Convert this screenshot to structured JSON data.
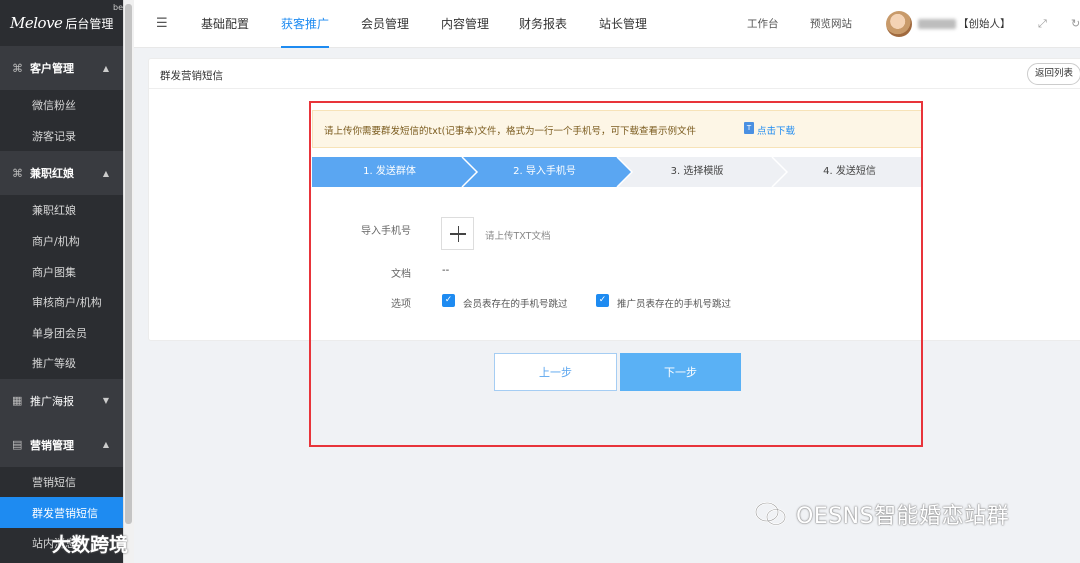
{
  "sidebar": {
    "logo_script": "Melove",
    "logo_admin": "后台管理",
    "logo_badge": "be",
    "groups": [
      {
        "label": "客户管理",
        "icon": "user-group-icon",
        "items": [
          "微信粉丝",
          "游客记录"
        ]
      },
      {
        "label": "兼职红娘",
        "icon": "user-group-icon",
        "items": [
          "兼职红娘",
          "商户/机构",
          "商户图集",
          "审核商户/机构",
          "单身团会员",
          "推广等级"
        ]
      },
      {
        "label": "推广海报",
        "icon": "calendar-icon",
        "items": []
      },
      {
        "label": "营销管理",
        "icon": "message-icon",
        "items": [
          "营销短信",
          "群发营销短信",
          "站内消息"
        ]
      }
    ],
    "active_item": "群发营销短信"
  },
  "topbar": {
    "menu_icon": "menu-toggle-icon",
    "tabs": [
      "基础配置",
      "获客推广",
      "会员管理",
      "内容管理",
      "财务报表",
      "站长管理"
    ],
    "active_tab": "获客推广",
    "workbench": "工作台",
    "preview": "预览网站",
    "user_role": "【创始人】",
    "icons": [
      "fullscreen-icon",
      "refresh-icon"
    ]
  },
  "page": {
    "title": "群发营销短信",
    "back_button": "返回列表",
    "notice_text": "请上传你需要群发短信的txt(记事本)文件，格式为一行一个手机号，可下载查看示例文件",
    "notice_link": "点击下载",
    "steps": [
      {
        "label": "1. 发送群体",
        "state": "done"
      },
      {
        "label": "2. 导入手机号",
        "state": "active"
      },
      {
        "label": "3. 选择模版",
        "state": "todo"
      },
      {
        "label": "4. 发送短信",
        "state": "todo"
      }
    ],
    "form": {
      "import_label": "导入手机号",
      "upload_hint": "请上传TXT文档",
      "doc_label": "文档",
      "doc_value": "--",
      "options_label": "选项",
      "option1": "会员表存在的手机号跳过",
      "option2": "推广员表存在的手机号跳过",
      "option1_checked": true,
      "option2_checked": true
    },
    "prev_button": "上一步",
    "next_button": "下一步"
  },
  "watermarks": {
    "right": "OESNS智能婚恋站群",
    "left": "大数跨境"
  },
  "colors": {
    "accent": "#1e8bf1",
    "sidebar_bg": "#2b2d31",
    "highlight": "#e8343a",
    "step_active": "#5aa6f2",
    "step_todo": "#eef0f4"
  }
}
